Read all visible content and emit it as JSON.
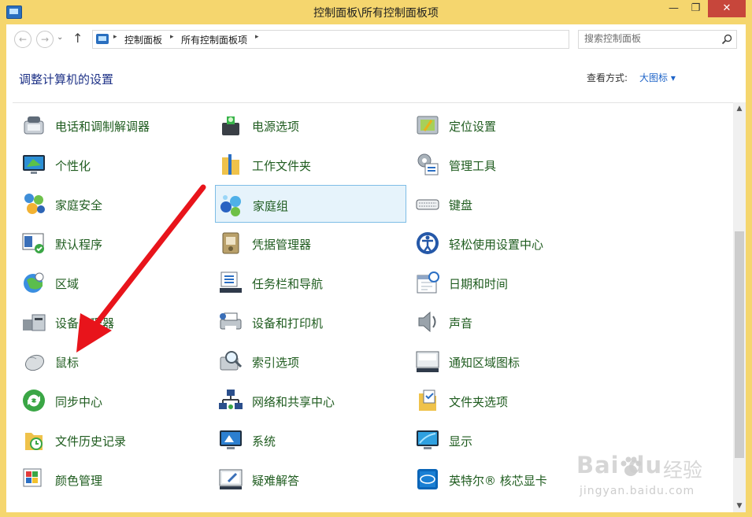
{
  "window": {
    "title": "控制面板\\所有控制面板项",
    "min_glyph": "—",
    "max_glyph": "❐",
    "close_glyph": "✕"
  },
  "address": {
    "back_glyph": "←",
    "forward_glyph": "→",
    "up_glyph": "↑",
    "crumb_sep": "▸",
    "crumbs": [
      "控制面板",
      "所有控制面板项"
    ],
    "dropdown_glyph": "⌄",
    "refresh_glyph": "↻"
  },
  "search": {
    "placeholder": "搜索控制面板"
  },
  "header": {
    "title": "调整计算机的设置",
    "view_label": "查看方式:",
    "view_value": "大图标 ▾"
  },
  "items": [
    {
      "label": "电话和调制解调器",
      "icon": "phone-modem-icon"
    },
    {
      "label": "电源选项",
      "icon": "power-options-icon"
    },
    {
      "label": "定位设置",
      "icon": "location-settings-icon"
    },
    {
      "label": "个性化",
      "icon": "personalization-icon"
    },
    {
      "label": "工作文件夹",
      "icon": "work-folders-icon"
    },
    {
      "label": "管理工具",
      "icon": "admin-tools-icon"
    },
    {
      "label": "家庭安全",
      "icon": "family-safety-icon"
    },
    {
      "label": "家庭组",
      "icon": "homegroup-icon"
    },
    {
      "label": "键盘",
      "icon": "keyboard-icon"
    },
    {
      "label": "默认程序",
      "icon": "default-programs-icon"
    },
    {
      "label": "凭据管理器",
      "icon": "credential-manager-icon"
    },
    {
      "label": "轻松使用设置中心",
      "icon": "ease-of-access-icon"
    },
    {
      "label": "区域",
      "icon": "region-icon"
    },
    {
      "label": "任务栏和导航",
      "icon": "taskbar-navigation-icon"
    },
    {
      "label": "日期和时间",
      "icon": "date-time-icon"
    },
    {
      "label": "设备管理器",
      "icon": "device-manager-icon"
    },
    {
      "label": "设备和打印机",
      "icon": "devices-printers-icon"
    },
    {
      "label": "声音",
      "icon": "sound-icon"
    },
    {
      "label": "鼠标",
      "icon": "mouse-icon"
    },
    {
      "label": "索引选项",
      "icon": "indexing-options-icon"
    },
    {
      "label": "通知区域图标",
      "icon": "notification-area-icon"
    },
    {
      "label": "同步中心",
      "icon": "sync-center-icon"
    },
    {
      "label": "网络和共享中心",
      "icon": "network-sharing-icon"
    },
    {
      "label": "文件夹选项",
      "icon": "folder-options-icon"
    },
    {
      "label": "文件历史记录",
      "icon": "file-history-icon"
    },
    {
      "label": "系统",
      "icon": "system-icon"
    },
    {
      "label": "显示",
      "icon": "display-icon"
    },
    {
      "label": "颜色管理",
      "icon": "color-management-icon"
    },
    {
      "label": "疑难解答",
      "icon": "troubleshooting-icon"
    },
    {
      "label": "英特尔® 核芯显卡",
      "icon": "intel-graphics-icon"
    }
  ],
  "selected_item": "家庭组",
  "scroll": {
    "up_glyph": "▲",
    "down_glyph": "▼"
  },
  "watermark": {
    "brand": "Bai  du",
    "cn": "经验",
    "url": "jingyan.baidu.com"
  },
  "colors": {
    "frame": "#f5d66e",
    "item_text": "#1f5c1f",
    "page_title": "#1e3287",
    "link": "#1e64c8",
    "selection_bg": "#e6f3fb",
    "selection_border": "#7ebde6",
    "close_button": "#c7463b",
    "arrow": "#e8141b"
  }
}
